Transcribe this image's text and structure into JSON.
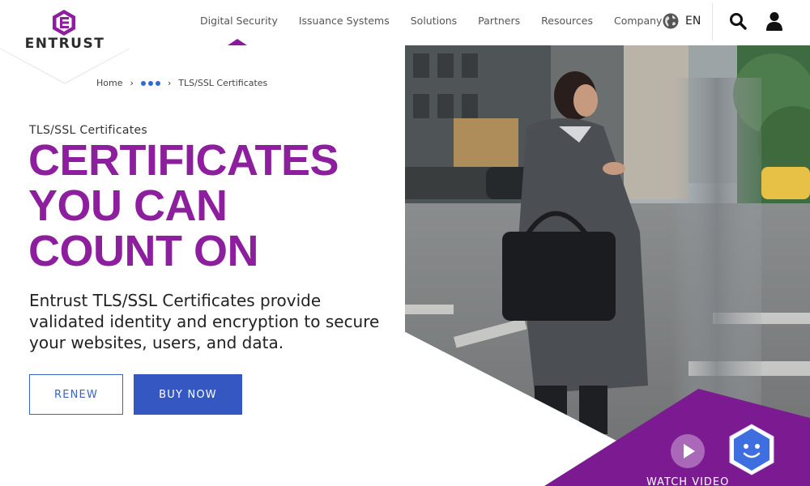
{
  "brand": {
    "name": "ENTRUST",
    "color": "#8d1f9e"
  },
  "nav": {
    "items": [
      "Digital Security",
      "Issuance Systems",
      "Solutions",
      "Partners",
      "Resources",
      "Company"
    ],
    "active": "Digital Security",
    "language": "EN"
  },
  "breadcrumb": {
    "home": "Home",
    "current": "TLS/SSL Certificates"
  },
  "hero": {
    "eyebrow": "TLS/SSL Certificates",
    "headline": [
      "CERTIFICATES",
      "YOU CAN",
      "COUNT ON"
    ],
    "lead": "Entrust TLS/SSL Certificates provide validated identity and encryption to secure your websites, users, and data.",
    "renew_label": "RENEW",
    "buy_label": "BUY NOW",
    "watch_label": "WATCH VIDEO"
  },
  "colors": {
    "accent": "#8d1f9e",
    "button_blue": "#3457c1",
    "triangle": "#7c1a92"
  }
}
